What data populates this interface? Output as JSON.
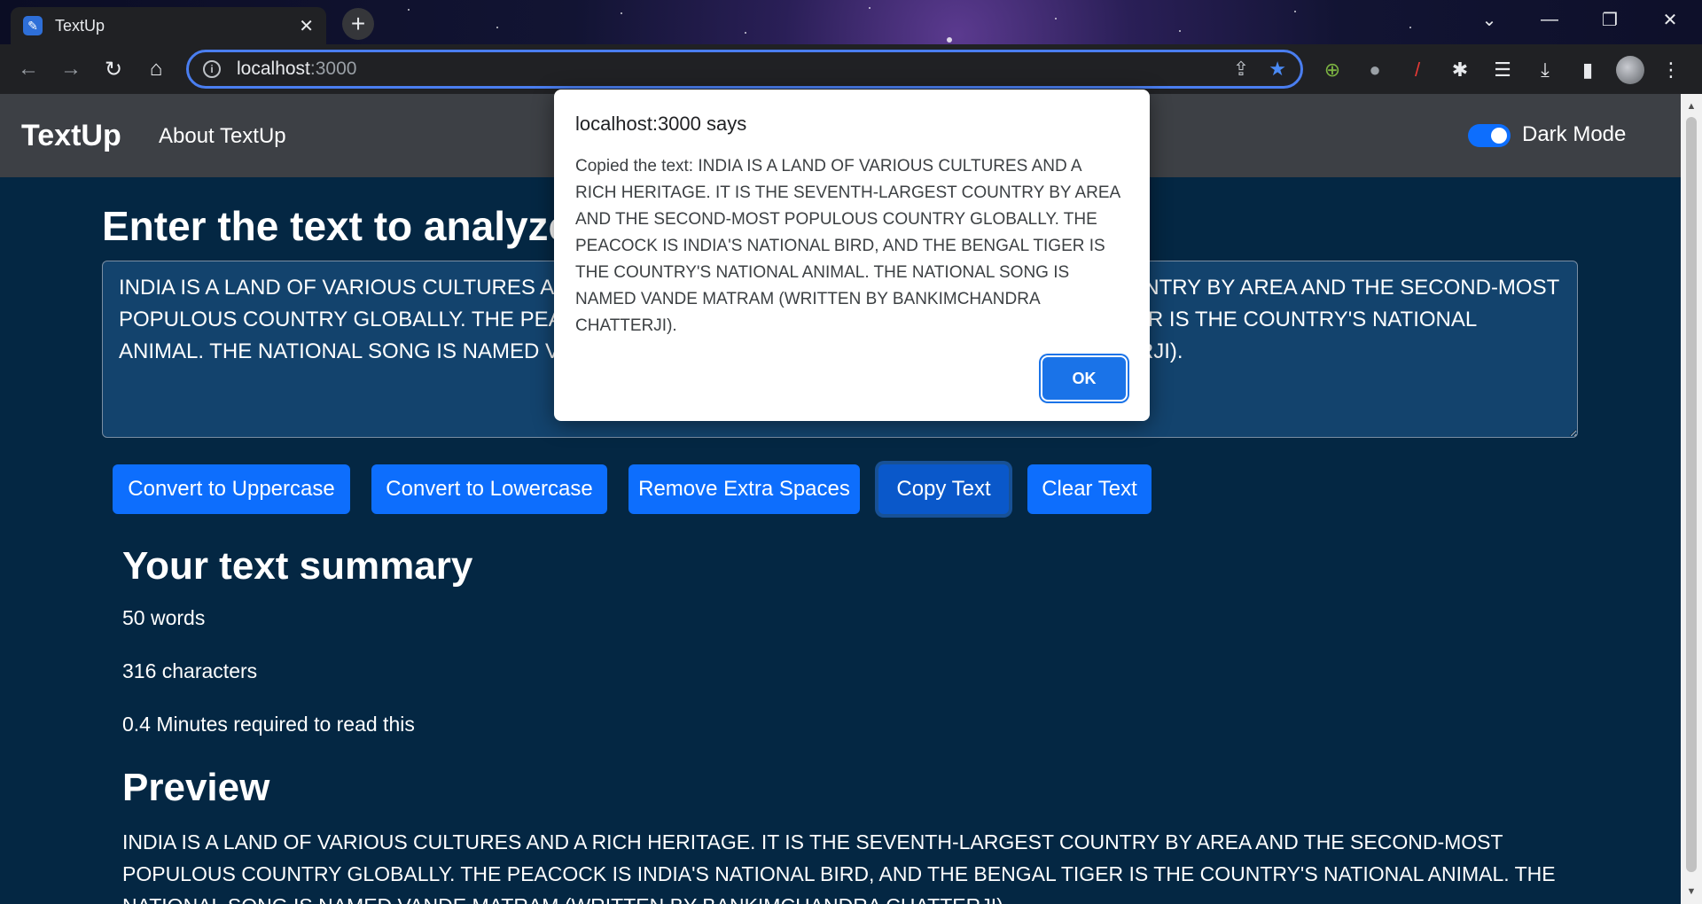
{
  "browser": {
    "tab_title": "TextUp",
    "url_host": "localhost",
    "url_port": ":3000"
  },
  "page": {
    "brand": "TextUp",
    "nav_link": "About TextUp",
    "dark_mode_label": "Dark Mode",
    "heading": "Enter the text to analyze",
    "textarea_value": "INDIA IS A LAND OF VARIOUS CULTURES AND A RICH HERITAGE. IT IS THE SEVENTH-LARGEST COUNTRY BY AREA AND THE SECOND-MOST POPULOUS COUNTRY GLOBALLY. THE PEACOCK IS INDIA'S NATIONAL BIRD, AND THE BENGAL TIGER IS THE COUNTRY'S NATIONAL ANIMAL. THE NATIONAL SONG IS NAMED VANDE MATRAM (WRITTEN BY BANKIMCHANDRA CHATTERJI).",
    "buttons": {
      "uppercase": "Convert to Uppercase",
      "lowercase": "Convert to Lowercase",
      "extra_spaces": "Remove Extra Spaces",
      "copy": "Copy Text",
      "clear": "Clear Text"
    },
    "summary_title": "Your text summary",
    "words": "50 words",
    "characters": "316 characters",
    "read_time": "0.4 Minutes required to read this",
    "preview_title": "Preview",
    "preview_text": "INDIA IS A LAND OF VARIOUS CULTURES AND A RICH HERITAGE. IT IS THE SEVENTH-LARGEST COUNTRY BY AREA AND THE SECOND-MOST POPULOUS COUNTRY GLOBALLY. THE PEACOCK IS INDIA'S NATIONAL BIRD, AND THE BENGAL TIGER IS THE COUNTRY'S NATIONAL ANIMAL. THE NATIONAL SONG IS NAMED VANDE MATRAM (WRITTEN BY BANKIMCHANDRA CHATTERJI)."
  },
  "dialog": {
    "title": "localhost:3000 says",
    "message": "Copied the text: INDIA IS A LAND OF VARIOUS CULTURES AND A RICH HERITAGE. IT IS THE SEVENTH-LARGEST COUNTRY BY AREA AND THE SECOND-MOST POPULOUS COUNTRY GLOBALLY. THE PEACOCK IS INDIA'S NATIONAL BIRD, AND THE BENGAL TIGER IS THE COUNTRY'S NATIONAL ANIMAL. THE NATIONAL SONG IS NAMED VANDE MATRAM (WRITTEN BY BANKIMCHANDRA CHATTERJI).",
    "ok_label": "OK"
  },
  "colors": {
    "page_background": "#042743",
    "navbar": "#3d4045",
    "primary_button": "#0d6efd",
    "dialog_ok": "#1a73e8"
  },
  "icons": [
    "new-tab-icon",
    "back-icon",
    "forward-icon",
    "reload-icon",
    "home-icon",
    "info-icon",
    "share-icon",
    "bookmark-star-icon",
    "extensions-icon",
    "download-icon",
    "side-panel-icon",
    "menu-icon"
  ]
}
